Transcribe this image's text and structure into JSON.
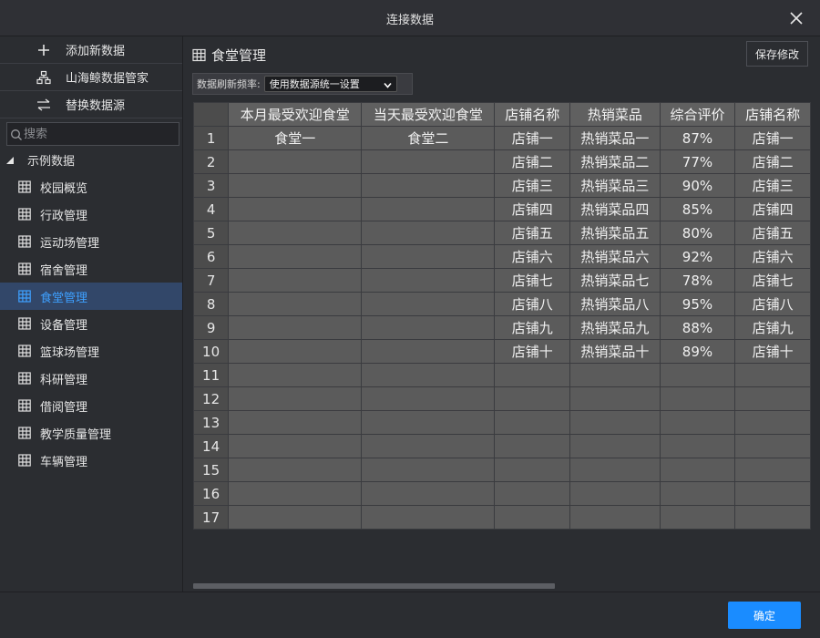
{
  "dialog": {
    "title": "连接数据",
    "ok_label": "确定",
    "close_icon": "close-icon"
  },
  "sidebar": {
    "actions": [
      {
        "label": "添加新数据",
        "icon": "plus-icon"
      },
      {
        "label": "山海鲸数据管家",
        "icon": "hierarchy-icon"
      },
      {
        "label": "替换数据源",
        "icon": "swap-arrows-icon"
      }
    ],
    "search_placeholder": "搜索",
    "root_label": "示例数据",
    "items": [
      {
        "label": "校园概览"
      },
      {
        "label": "行政管理"
      },
      {
        "label": "运动场管理"
      },
      {
        "label": "宿舍管理"
      },
      {
        "label": "食堂管理",
        "active": true
      },
      {
        "label": "设备管理"
      },
      {
        "label": "篮球场管理"
      },
      {
        "label": "科研管理"
      },
      {
        "label": "借阅管理"
      },
      {
        "label": "教学质量管理"
      },
      {
        "label": "车辆管理"
      }
    ]
  },
  "main": {
    "title": "食堂管理",
    "save_label": "保存修改",
    "refresh_label": "数据刷新频率:",
    "refresh_value": "使用数据源统一设置"
  },
  "table": {
    "columns": [
      "本月最受欢迎食堂",
      "当天最受欢迎食堂",
      "店铺名称",
      "热销菜品",
      "综合评价",
      "店铺名称"
    ],
    "rows": [
      [
        "食堂一",
        "食堂二",
        "店铺一",
        "热销菜品一",
        "87%",
        "店铺一"
      ],
      [
        "",
        "",
        "店铺二",
        "热销菜品二",
        "77%",
        "店铺二"
      ],
      [
        "",
        "",
        "店铺三",
        "热销菜品三",
        "90%",
        "店铺三"
      ],
      [
        "",
        "",
        "店铺四",
        "热销菜品四",
        "85%",
        "店铺四"
      ],
      [
        "",
        "",
        "店铺五",
        "热销菜品五",
        "80%",
        "店铺五"
      ],
      [
        "",
        "",
        "店铺六",
        "热销菜品六",
        "92%",
        "店铺六"
      ],
      [
        "",
        "",
        "店铺七",
        "热销菜品七",
        "78%",
        "店铺七"
      ],
      [
        "",
        "",
        "店铺八",
        "热销菜品八",
        "95%",
        "店铺八"
      ],
      [
        "",
        "",
        "店铺九",
        "热销菜品九",
        "88%",
        "店铺九"
      ],
      [
        "",
        "",
        "店铺十",
        "热销菜品十",
        "89%",
        "店铺十"
      ],
      [
        "",
        "",
        "",
        "",
        "",
        ""
      ],
      [
        "",
        "",
        "",
        "",
        "",
        ""
      ],
      [
        "",
        "",
        "",
        "",
        "",
        ""
      ],
      [
        "",
        "",
        "",
        "",
        "",
        ""
      ],
      [
        "",
        "",
        "",
        "",
        "",
        ""
      ],
      [
        "",
        "",
        "",
        "",
        "",
        ""
      ],
      [
        "",
        "",
        "",
        "",
        "",
        ""
      ]
    ]
  },
  "colors": {
    "accent": "#1a8cff",
    "active_bg": "#324769",
    "active_text": "#3ea0ff"
  }
}
